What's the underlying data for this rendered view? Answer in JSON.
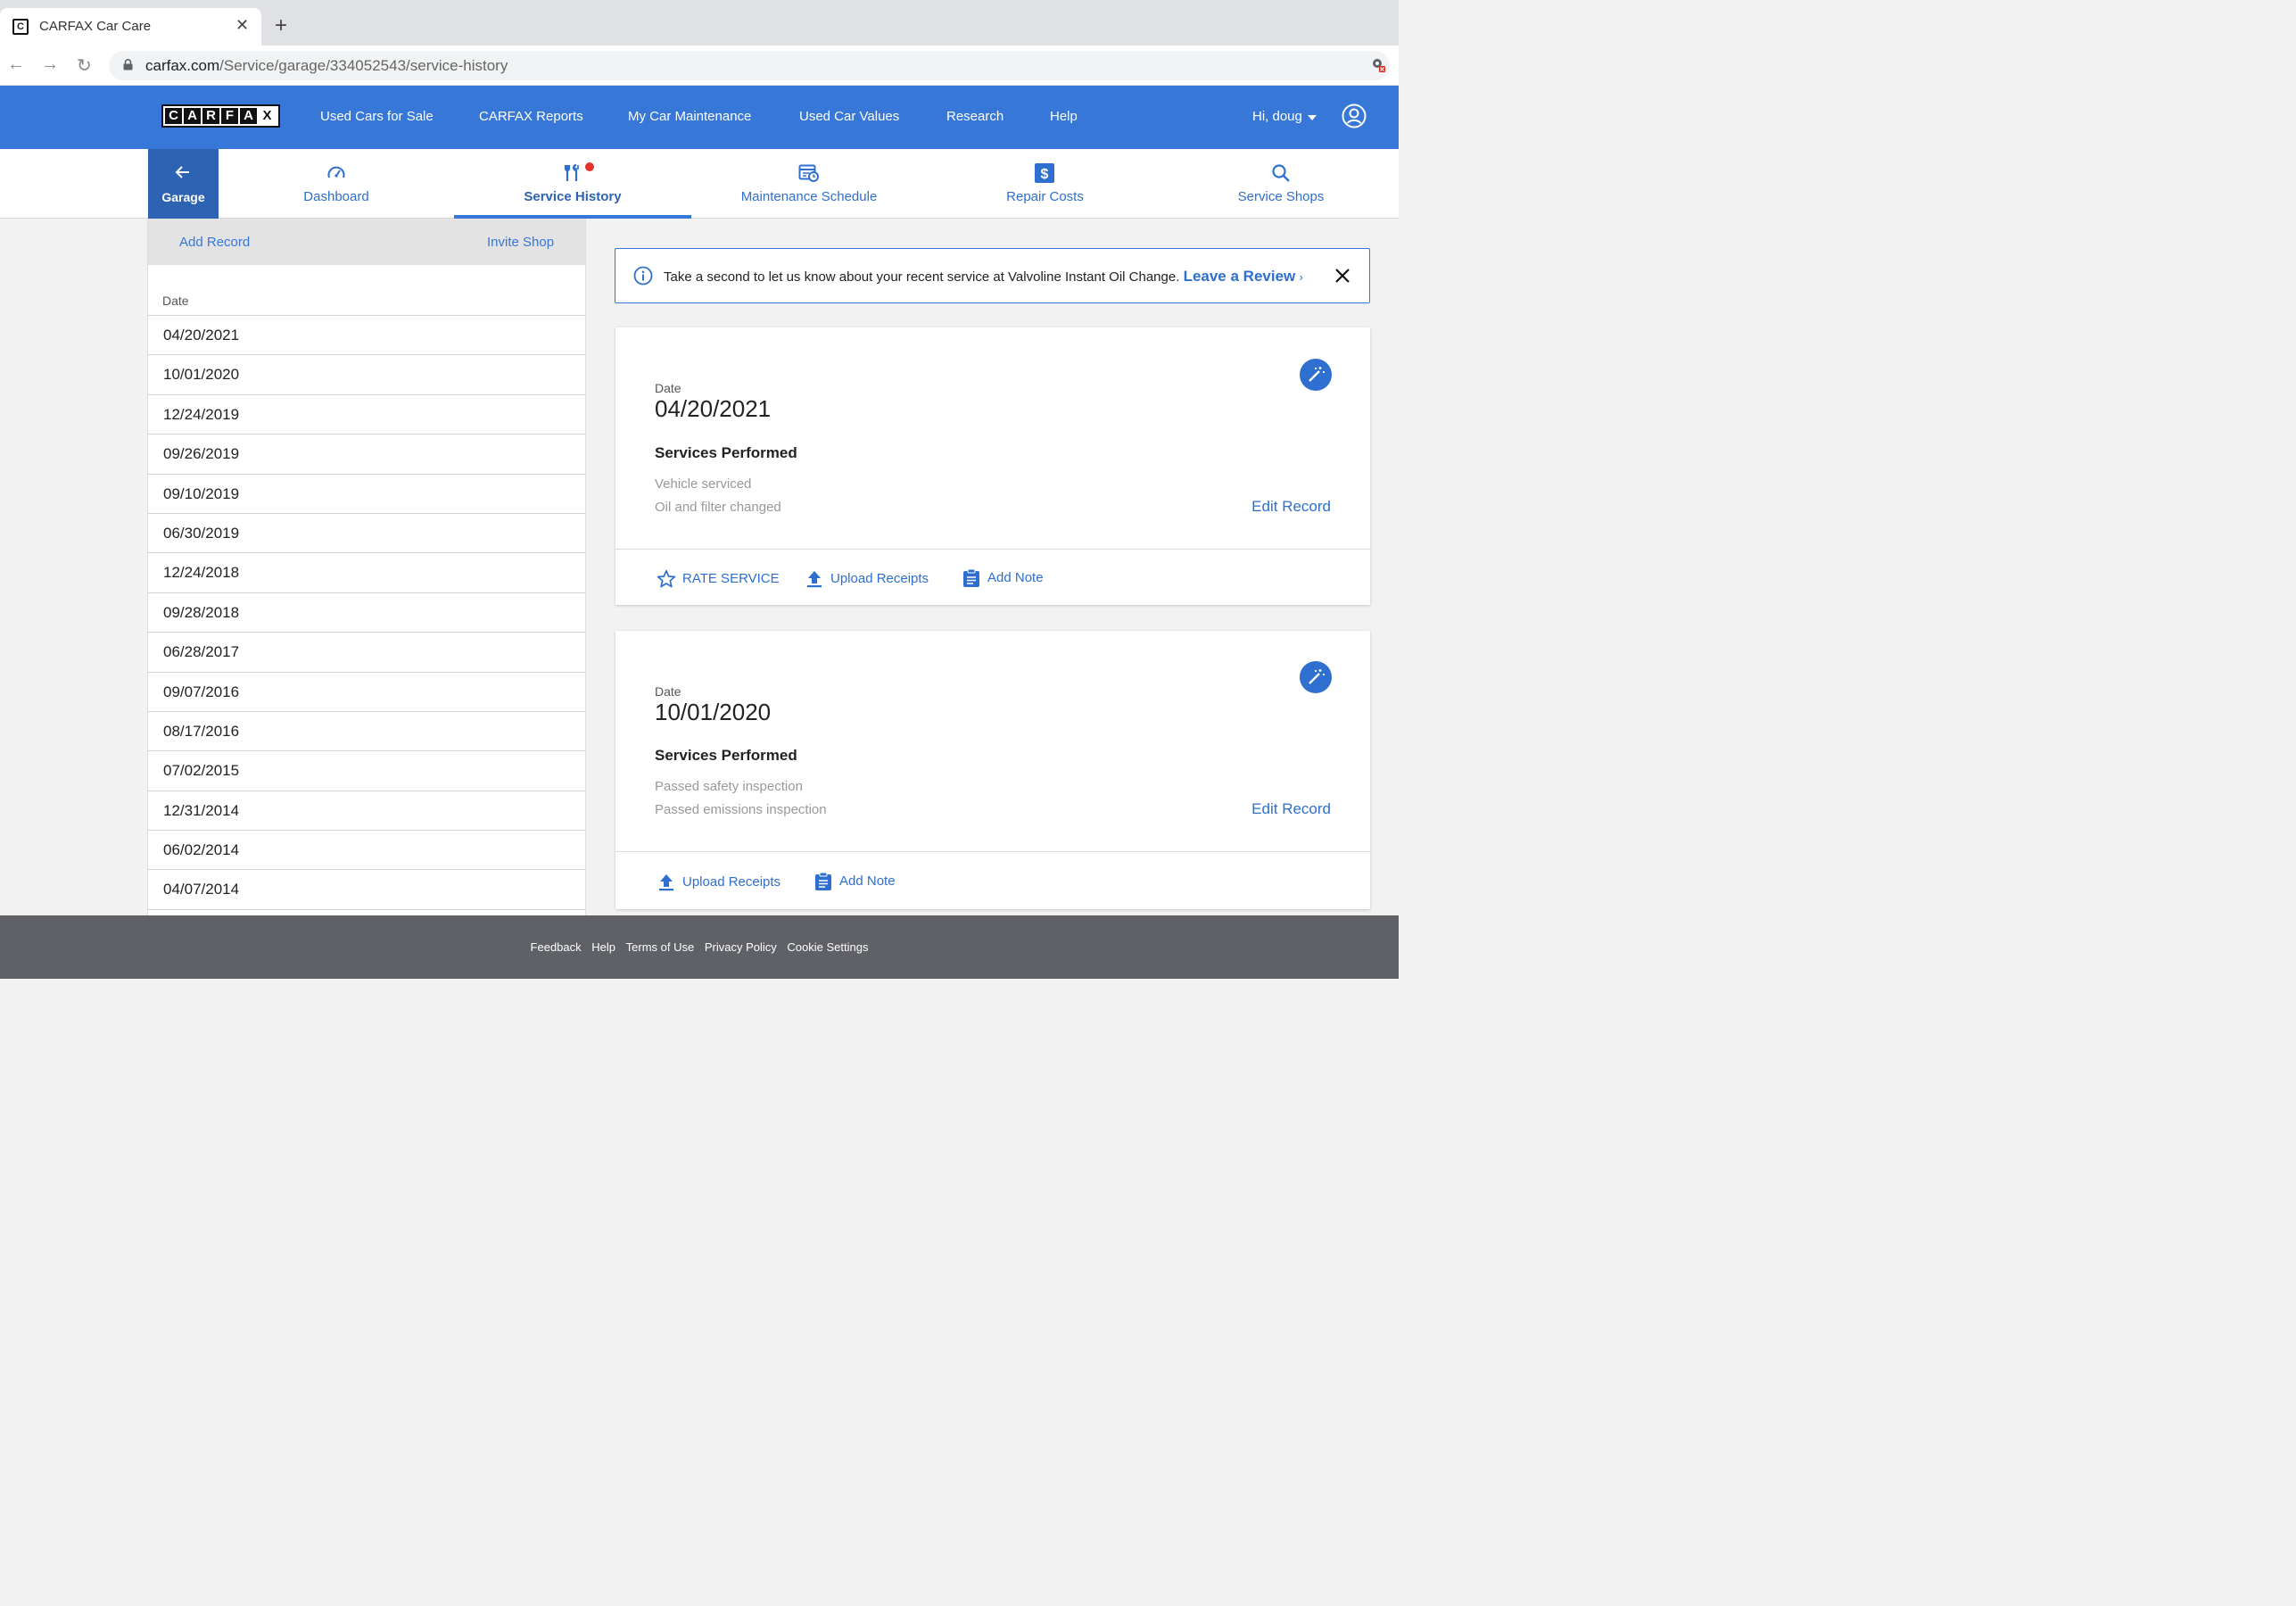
{
  "browser": {
    "tab_title": "CARFAX Car Care",
    "url_host": "carfax.com",
    "url_path": "/Service/garage/334052543/service-history"
  },
  "header": {
    "logo_letters": [
      "C",
      "A",
      "R",
      "F",
      "A",
      "X"
    ],
    "nav": [
      "Used Cars for Sale",
      "CARFAX Reports",
      "My Car Maintenance",
      "Used Car Values",
      "Research",
      "Help"
    ],
    "greeting": "Hi, doug"
  },
  "subnav": {
    "back_label": "Garage",
    "items": [
      {
        "label": "Dashboard",
        "icon": "speedometer-icon"
      },
      {
        "label": "Service History",
        "icon": "tools-icon",
        "active": true
      },
      {
        "label": "Maintenance Schedule",
        "icon": "calendar-clock-icon"
      },
      {
        "label": "Repair Costs",
        "icon": "dollar-icon"
      },
      {
        "label": "Service Shops",
        "icon": "search-icon"
      }
    ]
  },
  "sidebar": {
    "add_record": "Add Record",
    "invite_shop": "Invite Shop",
    "column_header": "Date",
    "dates": [
      "04/20/2021",
      "10/01/2020",
      "12/24/2019",
      "09/26/2019",
      "09/10/2019",
      "06/30/2019",
      "12/24/2018",
      "09/28/2018",
      "06/28/2017",
      "09/07/2016",
      "08/17/2016",
      "07/02/2015",
      "12/31/2014",
      "06/02/2014",
      "04/07/2014"
    ]
  },
  "banner": {
    "text": "Take a second to let us know about your recent service at Valvoline Instant Oil Change.",
    "link": "Leave a Review",
    "link_chevron": "›"
  },
  "records": [
    {
      "date_label": "Date",
      "date": "04/20/2021",
      "services_title": "Services Performed",
      "services": [
        "Vehicle serviced",
        "Oil and filter changed"
      ],
      "edit": "Edit Record",
      "rate": "RATE SERVICE",
      "upload": "Upload Receipts",
      "note": "Add Note"
    },
    {
      "date_label": "Date",
      "date": "10/01/2020",
      "services_title": "Services Performed",
      "services": [
        "Passed safety inspection",
        "Passed emissions inspection"
      ],
      "edit": "Edit Record",
      "upload": "Upload Receipts",
      "note": "Add Note"
    }
  ],
  "footer": {
    "links": [
      "Feedback",
      "Help",
      "Terms of Use",
      "Privacy Policy",
      "Cookie Settings"
    ]
  },
  "colors": {
    "brand_blue": "#3777d8",
    "link_blue": "#2e6fcf",
    "footer_gray": "#5f6166",
    "notification_red": "#e0342c"
  }
}
